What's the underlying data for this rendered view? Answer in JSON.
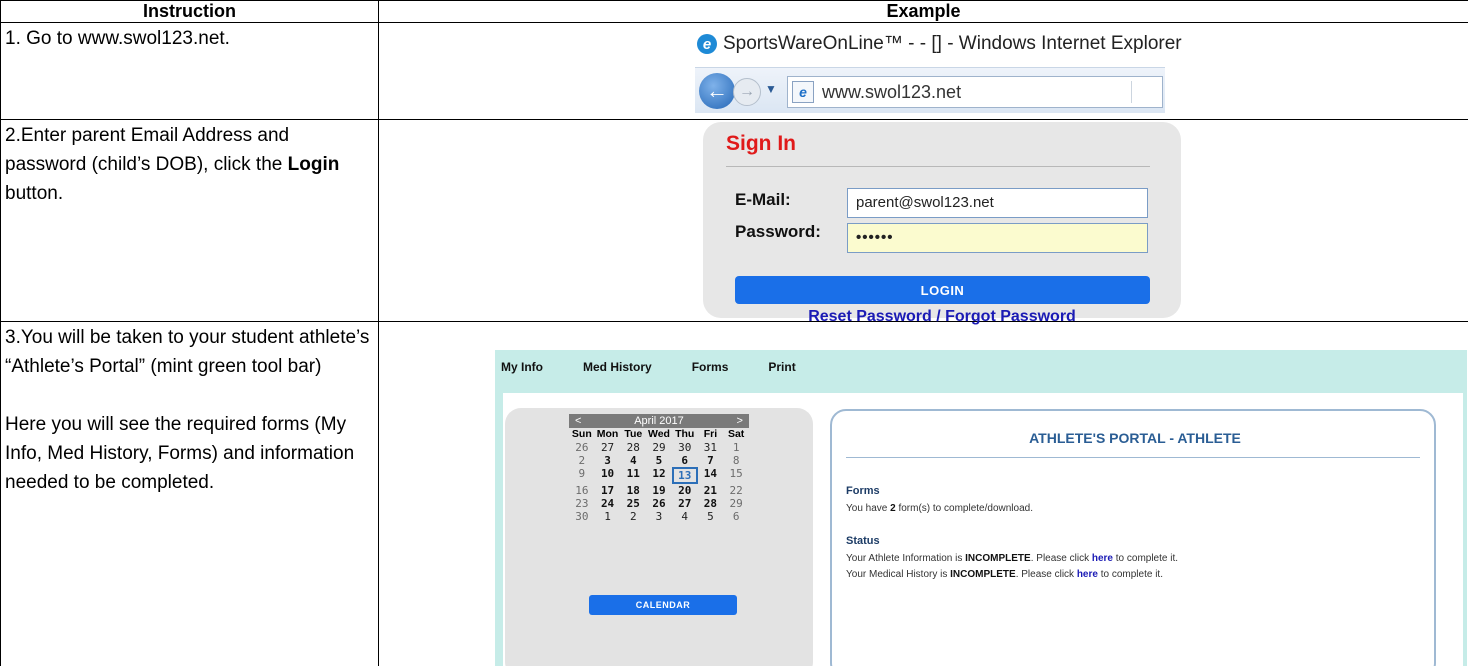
{
  "table": {
    "header_instruction": "Instruction",
    "header_example": "Example"
  },
  "rows": [
    {
      "instruction": "1. Go to www.swol123.net."
    },
    {
      "instruction_parts": [
        "2.Enter parent Email Address and password (child’s DOB), click the ",
        "Login",
        " button."
      ]
    },
    {
      "instruction_p1": "3.You will be taken to your student athlete’s “Athlete’s Portal” (mint green tool bar)",
      "instruction_p2": "Here you will see the required forms (My Info, Med History, Forms) and information needed to be completed."
    }
  ],
  "browser": {
    "logo_icon": "ie-logo-icon",
    "title": "SportsWareOnLine™ - - [] - Windows Internet Explorer",
    "address": "www.swol123.net"
  },
  "signin": {
    "title": "Sign In",
    "email_label": "E-Mail:",
    "password_label": "Password:",
    "email_value": "parent@swol123.net",
    "password_value": "••••••",
    "login_label": "LOGIN",
    "reset_link": "Reset Password / Forgot Password",
    "title_color": "#e01a1a",
    "button_color": "#1a6fe8"
  },
  "portal": {
    "menu": [
      "My Info",
      "Med History",
      "Forms",
      "Print"
    ],
    "calendar": {
      "month": "April 2017",
      "prev": "<",
      "next": ">",
      "days_of_week": [
        "Sun",
        "Mon",
        "Tue",
        "Wed",
        "Thu",
        "Fri",
        "Sat"
      ],
      "weeks": [
        [
          "26",
          "27",
          "28",
          "29",
          "30",
          "31",
          "1"
        ],
        [
          "2",
          "3",
          "4",
          "5",
          "6",
          "7",
          "8"
        ],
        [
          "9",
          "10",
          "11",
          "12",
          "13",
          "14",
          "15"
        ],
        [
          "16",
          "17",
          "18",
          "19",
          "20",
          "21",
          "22"
        ],
        [
          "23",
          "24",
          "25",
          "26",
          "27",
          "28",
          "29"
        ],
        [
          "30",
          "1",
          "2",
          "3",
          "4",
          "5",
          "6"
        ]
      ],
      "today": "13",
      "button": "CALENDAR"
    },
    "panel": {
      "title": "ATHLETE'S PORTAL - ATHLETE",
      "forms_heading": "Forms",
      "forms_text_pre": "You have ",
      "forms_count": "2",
      "forms_text_post": " form(s) to complete/download.",
      "status_heading": "Status",
      "status1_pre": "Your Athlete Information is ",
      "status1_state": "INCOMPLETE",
      "status1_mid": ". Please click ",
      "status1_link": "here",
      "status1_post": " to complete it.",
      "status2_pre": "Your Medical History is ",
      "status2_state": "INCOMPLETE",
      "status2_mid": ". Please click ",
      "status2_link": "here",
      "status2_post": " to complete it."
    },
    "toolbar_color": "#c6ece8"
  }
}
